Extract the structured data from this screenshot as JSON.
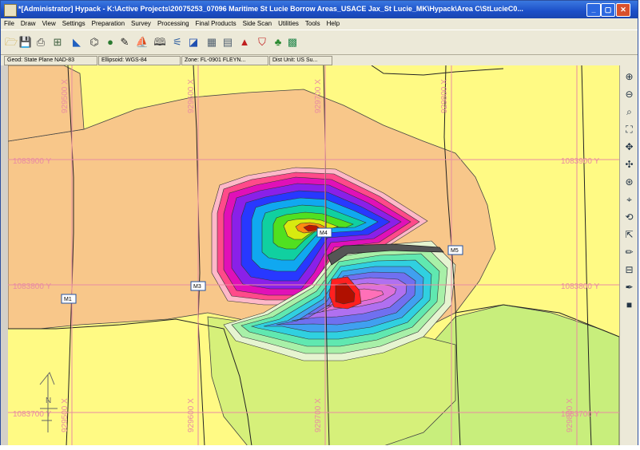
{
  "window": {
    "title": "*[Administrator] Hypack - K:\\Active Projects\\20075253_07096 Maritime St Lucie Borrow Areas_USACE Jax_St Lucie_MK\\Hypack\\Area C\\StLucieC0...",
    "minimize": "_",
    "maximize": "▢",
    "close": "✕"
  },
  "menu": [
    "File",
    "Draw",
    "View",
    "Settings",
    "Preparation",
    "Survey",
    "Processing",
    "Final Products",
    "Side Scan",
    "Utilities",
    "Tools",
    "Help"
  ],
  "toolbar": {
    "icons": [
      {
        "name": "open-folder-icon",
        "glyph": "🗁",
        "color": "#c8a030"
      },
      {
        "name": "save-icon",
        "glyph": "💾",
        "color": "#3050a0"
      },
      {
        "name": "print-icon",
        "glyph": "⎙",
        "color": "#404040"
      },
      {
        "name": "project-tree-icon",
        "glyph": "⊞",
        "color": "#406040"
      },
      {
        "name": "chart-icon",
        "glyph": "◣",
        "color": "#2060c0"
      },
      {
        "name": "planning-icon",
        "glyph": "⌬",
        "color": "#404040"
      },
      {
        "name": "globe-icon",
        "glyph": "●",
        "color": "#2a7a30"
      },
      {
        "name": "pen-icon",
        "glyph": "✎",
        "color": "#202020"
      },
      {
        "name": "boat-icon",
        "glyph": "⛵",
        "color": "#404040"
      },
      {
        "name": "book-icon",
        "glyph": "🕮",
        "color": "#404040"
      },
      {
        "name": "channel-icon",
        "glyph": "⚟",
        "color": "#3060a0"
      },
      {
        "name": "volume-icon",
        "glyph": "◪",
        "color": "#2050b0"
      },
      {
        "name": "grid-icon",
        "glyph": "▦",
        "color": "#506070"
      },
      {
        "name": "table-icon",
        "glyph": "▤",
        "color": "#506070"
      },
      {
        "name": "triangle-icon",
        "glyph": "▲",
        "color": "#c02020"
      },
      {
        "name": "shield-icon",
        "glyph": "⛉",
        "color": "#c01818"
      },
      {
        "name": "tree-icon",
        "glyph": "♣",
        "color": "#2a8a30"
      },
      {
        "name": "tin-icon",
        "glyph": "▩",
        "color": "#2a8a50"
      }
    ]
  },
  "status": {
    "geodesy": "Geod: State Plane NAD-83",
    "ellipsoid": "Ellipsoid: WGS-84",
    "zone": "Zone: FL-0901 FLEYN...",
    "units": "Dist Unit: US Su..."
  },
  "map": {
    "grid_labels": {
      "north_upper": "1083900 Y",
      "north_middle": "1083800 Y",
      "north_lower": "1083700 Y",
      "east_1": "929500 X",
      "east_2": "929600 X",
      "east_3": "929700 X",
      "east_4": "929800 X"
    },
    "markers": [
      "M1",
      "M3",
      "M4",
      "M5"
    ],
    "north_arrow": "N"
  },
  "ribbon": [
    {
      "name": "zoom-in-icon",
      "glyph": "⊕"
    },
    {
      "name": "zoom-out-icon",
      "glyph": "⊖"
    },
    {
      "name": "zoom-window-icon",
      "glyph": "⌕"
    },
    {
      "name": "zoom-extents-icon",
      "glyph": "⛶"
    },
    {
      "name": "pan-icon",
      "glyph": "✥"
    },
    {
      "name": "pan-arrows-icon",
      "glyph": "✣"
    },
    {
      "name": "crosshair-icon",
      "glyph": "⊛"
    },
    {
      "name": "center-icon",
      "glyph": "⌖"
    },
    {
      "name": "rotate-icon",
      "glyph": "⟲"
    },
    {
      "name": "select-pointer-icon",
      "glyph": "⇱"
    },
    {
      "name": "draw-pencil-icon",
      "glyph": "✏"
    },
    {
      "name": "measure-icon",
      "glyph": "⊟"
    },
    {
      "name": "edit-pen-icon",
      "glyph": "✒"
    },
    {
      "name": "fill-block-icon",
      "glyph": "■"
    }
  ],
  "colors": {
    "land_yellow": "#fffa84",
    "sand": "#f8c78a",
    "green": "#c8ee7c",
    "grid_red": "#e98ca2",
    "title_blue": "#1c4fc8"
  }
}
